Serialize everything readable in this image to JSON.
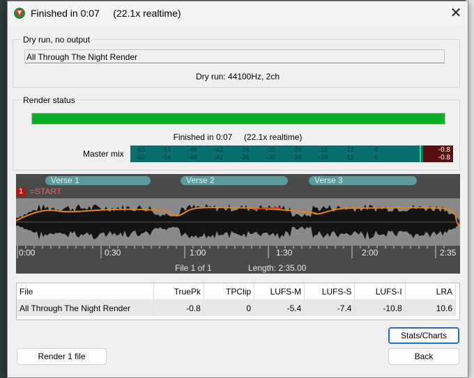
{
  "window": {
    "title": "Finished in 0:07     (22.1x realtime)",
    "close_icon": "close-icon"
  },
  "dry_run": {
    "group_label": "Dry run, no output",
    "render_name": "All Through The Night Render",
    "info": "Dry run: 44100Hz, 2ch"
  },
  "render_status": {
    "group_label": "Render status",
    "progress": 1.0,
    "finished_text": "Finished in 0:07     (22.1x realtime)",
    "master_label": "Master mix",
    "meter_ticks": [
      "-60",
      "-54",
      "-48",
      "-42",
      "-36",
      "-30",
      "-24",
      "-18",
      "-12",
      "-6"
    ],
    "peak_left": "-0.8",
    "peak_right": "-0.8",
    "colors": {
      "progress": "#06b025",
      "meter": "#0b6f6f",
      "peak": "#5a0f0f"
    }
  },
  "timeline": {
    "regions": [
      "Verse 1",
      "Verse 2",
      "Verse 3"
    ],
    "marker_number": "1",
    "marker_name": "=START",
    "ruler_labels": [
      "0:00",
      "0:30",
      "1:00",
      "1:30",
      "2:00",
      "2:35"
    ],
    "file_counter": "File 1 of 1",
    "length": "Length: 2:35.00"
  },
  "stats": {
    "headers": [
      "File",
      "TruePk",
      "TPClip",
      "LUFS-M",
      "LUFS-S",
      "LUFS-I",
      "LRA"
    ],
    "rows": [
      [
        "All Through The Night Render",
        "-0.8",
        "0",
        "-5.4",
        "-7.4",
        "-10.8",
        "10.6"
      ]
    ]
  },
  "buttons": {
    "render": "Render 1 file",
    "stats_charts": "Stats/Charts",
    "back": "Back"
  }
}
